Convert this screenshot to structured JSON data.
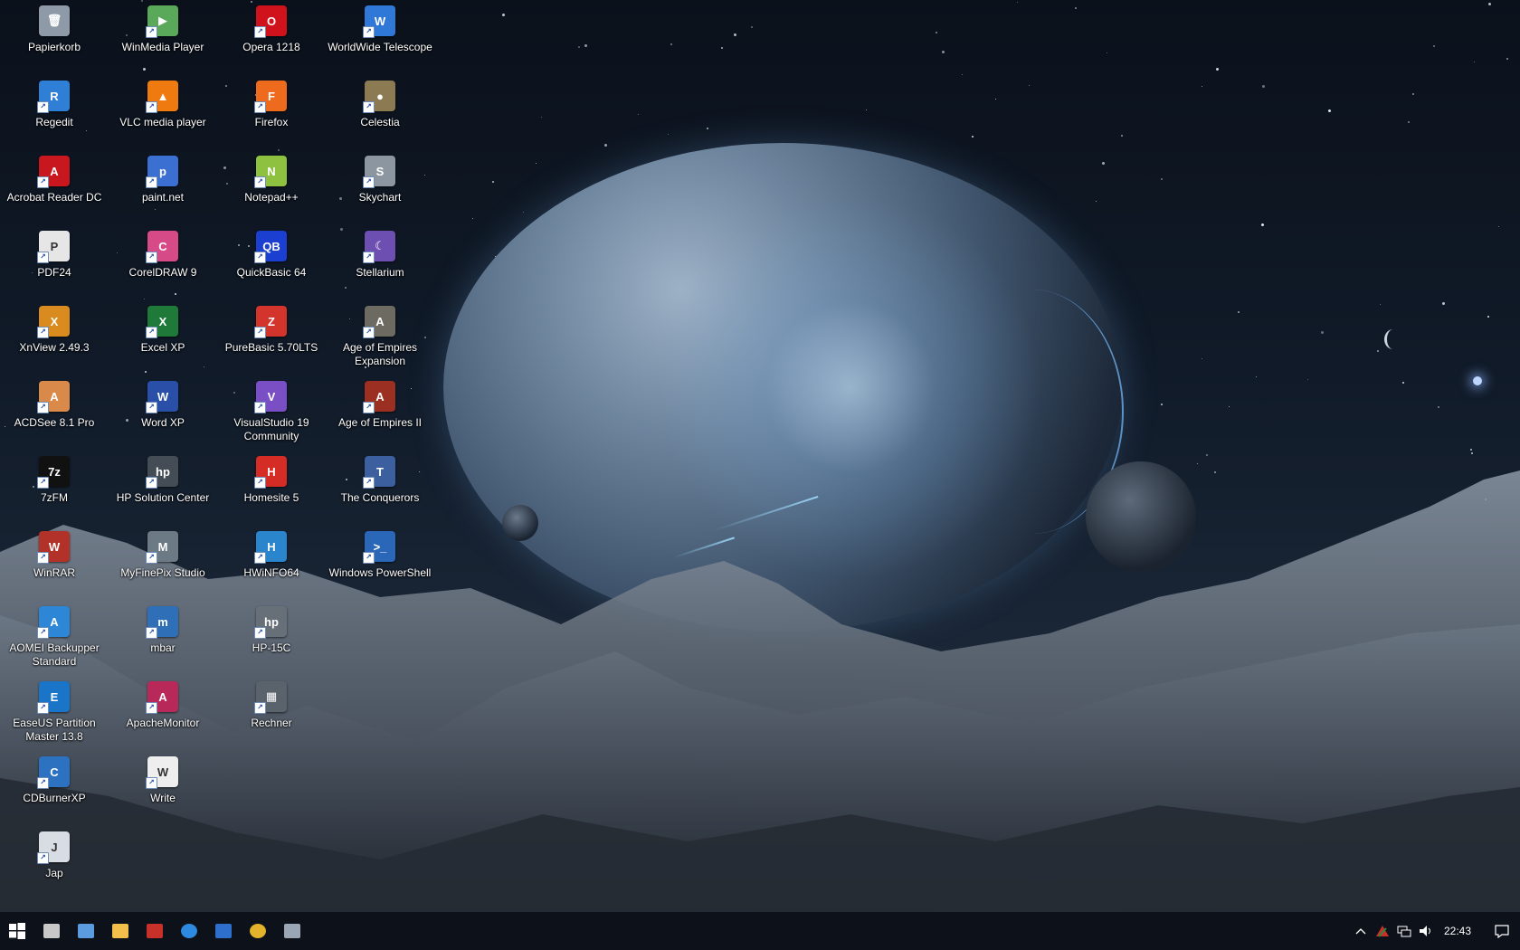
{
  "desktop": {
    "icons": [
      {
        "label": "Papierkorb",
        "glyph": "🗑",
        "color": "#8e9aa8"
      },
      {
        "label": "Regedit",
        "glyph": "R",
        "color": "#2f7fd6"
      },
      {
        "label": "Acrobat Reader DC",
        "glyph": "A",
        "color": "#c8171e"
      },
      {
        "label": "PDF24",
        "glyph": "P",
        "color": "#e6e6e6"
      },
      {
        "label": "XnView 2.49.3",
        "glyph": "X",
        "color": "#d98b1f"
      },
      {
        "label": "ACDSee 8.1 Pro",
        "glyph": "A",
        "color": "#d98a4a"
      },
      {
        "label": "7zFM",
        "glyph": "7z",
        "color": "#111111"
      },
      {
        "label": "WinRAR",
        "glyph": "W",
        "color": "#b2322a"
      },
      {
        "label": "AOMEI Backupper Standard",
        "glyph": "A",
        "color": "#2e86d6"
      },
      {
        "label": "EaseUS Partition Master 13.8",
        "glyph": "E",
        "color": "#1a74c8"
      },
      {
        "label": "CDBurnerXP",
        "glyph": "C",
        "color": "#2d72c0"
      },
      {
        "label": "Jap",
        "glyph": "J",
        "color": "#d8dde3"
      },
      {
        "label": "WinMedia Player",
        "glyph": "▶",
        "color": "#5aa85a"
      },
      {
        "label": "VLC media player",
        "glyph": "▲",
        "color": "#ee7a10"
      },
      {
        "label": "paint.net",
        "glyph": "p",
        "color": "#3b6fd2"
      },
      {
        "label": "CorelDRAW 9",
        "glyph": "C",
        "color": "#d64b87"
      },
      {
        "label": "Excel XP",
        "glyph": "X",
        "color": "#1f7a3a"
      },
      {
        "label": "Word XP",
        "glyph": "W",
        "color": "#2a4fa8"
      },
      {
        "label": "HP Solution Center",
        "glyph": "hp",
        "color": "#444c56"
      },
      {
        "label": "MyFinePix Studio",
        "glyph": "M",
        "color": "#6c7a86"
      },
      {
        "label": "mbar",
        "glyph": "m",
        "color": "#2e6fb8"
      },
      {
        "label": "ApacheMonitor",
        "glyph": "A",
        "color": "#b8295a"
      },
      {
        "label": "Write",
        "glyph": "W",
        "color": "#eeeeee"
      },
      {
        "label": "Opera 1218",
        "glyph": "O",
        "color": "#d0121d"
      },
      {
        "label": "Firefox",
        "glyph": "F",
        "color": "#ee6a1c"
      },
      {
        "label": "Notepad++",
        "glyph": "N",
        "color": "#8dc13f"
      },
      {
        "label": "QuickBasic 64",
        "glyph": "QB",
        "color": "#1a3fd1"
      },
      {
        "label": "PureBasic 5.70LTS",
        "glyph": "Z",
        "color": "#d3352d"
      },
      {
        "label": "VisualStudio 19 Community",
        "glyph": "V",
        "color": "#7a4ec4"
      },
      {
        "label": "Homesite 5",
        "glyph": "H",
        "color": "#d62c26"
      },
      {
        "label": "HWiNFO64",
        "glyph": "H",
        "color": "#2b85cc"
      },
      {
        "label": "HP-15C",
        "glyph": "hp",
        "color": "#676f78"
      },
      {
        "label": "Rechner",
        "glyph": "▦",
        "color": "#5a626c"
      },
      {
        "label": "WorldWide Telescope",
        "glyph": "W",
        "color": "#2f78d8"
      },
      {
        "label": "Celestia",
        "glyph": "●",
        "color": "#8c7a52"
      },
      {
        "label": "Skychart",
        "glyph": "S",
        "color": "#8c96a0"
      },
      {
        "label": "Stellarium",
        "glyph": "☾",
        "color": "#6d4fb2"
      },
      {
        "label": "Age of Empires Expansion",
        "glyph": "A",
        "color": "#6d6a62"
      },
      {
        "label": "Age of Empires II",
        "glyph": "A",
        "color": "#9a2f22"
      },
      {
        "label": "The Conquerors",
        "glyph": "T",
        "color": "#3c5fa0"
      },
      {
        "label": "Windows PowerShell",
        "glyph": ">_",
        "color": "#2a67b8"
      }
    ]
  },
  "taskbar": {
    "apps": [
      {
        "name": "start",
        "color": "#ffffff"
      },
      {
        "name": "cmd",
        "color": "#c8c8c8"
      },
      {
        "name": "window",
        "color": "#5b9be0"
      },
      {
        "name": "explorer",
        "color": "#f2c04a"
      },
      {
        "name": "pdf",
        "color": "#c8302a"
      },
      {
        "name": "edge",
        "color": "#2d8ae0"
      },
      {
        "name": "outlook",
        "color": "#2f6fcc"
      },
      {
        "name": "chrome",
        "color": "#e2b32b"
      },
      {
        "name": "tool",
        "color": "#9aa6b4"
      }
    ],
    "clock": "22:43"
  }
}
